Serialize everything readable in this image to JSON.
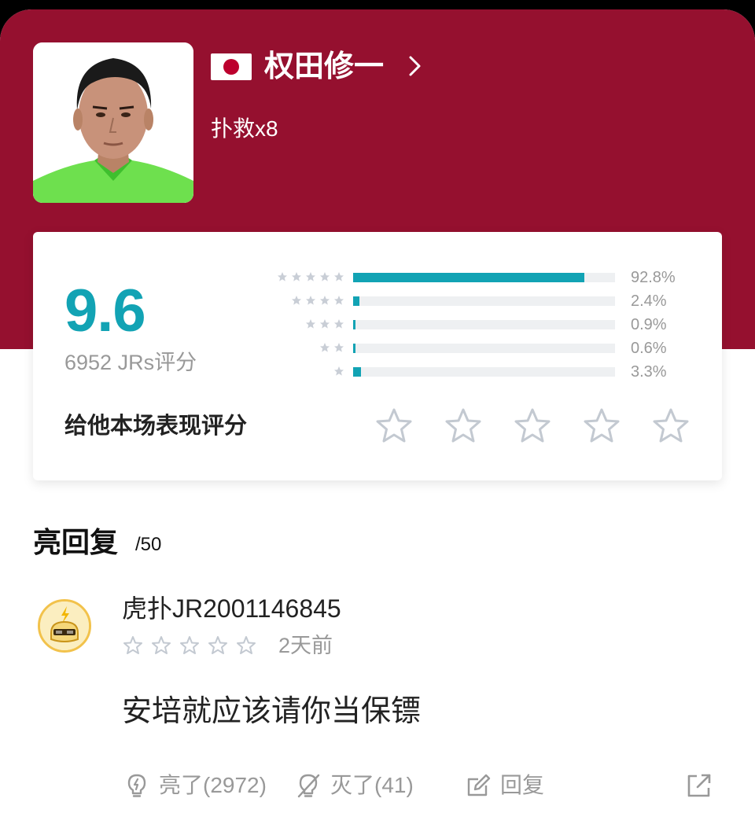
{
  "player": {
    "country_flag": "japan-flag",
    "name": "权田修一",
    "stat": "扑救x8"
  },
  "rating": {
    "score": "9.6",
    "count_label": "6952 JRs评分",
    "accent_color": "#12a3b4",
    "distribution": [
      {
        "stars": 5,
        "percent": 92.8,
        "label": "92.8%"
      },
      {
        "stars": 4,
        "percent": 2.4,
        "label": "2.4%"
      },
      {
        "stars": 3,
        "percent": 0.9,
        "label": "0.9%"
      },
      {
        "stars": 2,
        "percent": 0.6,
        "label": "0.6%"
      },
      {
        "stars": 1,
        "percent": 3.3,
        "label": "3.3%"
      }
    ],
    "prompt": "给他本场表现评分",
    "user_rating": 0
  },
  "replies": {
    "title": "亮回复",
    "count": "/50",
    "items": [
      {
        "username": "虎扑JR2001146845",
        "star_rating": 0,
        "time": "2天前",
        "text": "安培就应该请你当保镖",
        "like_label": "亮了(2972)",
        "dislike_label": "灭了(41)",
        "reply_label": "回复"
      }
    ]
  },
  "theme": {
    "header_color": "#95102f",
    "text_muted": "#999999"
  }
}
